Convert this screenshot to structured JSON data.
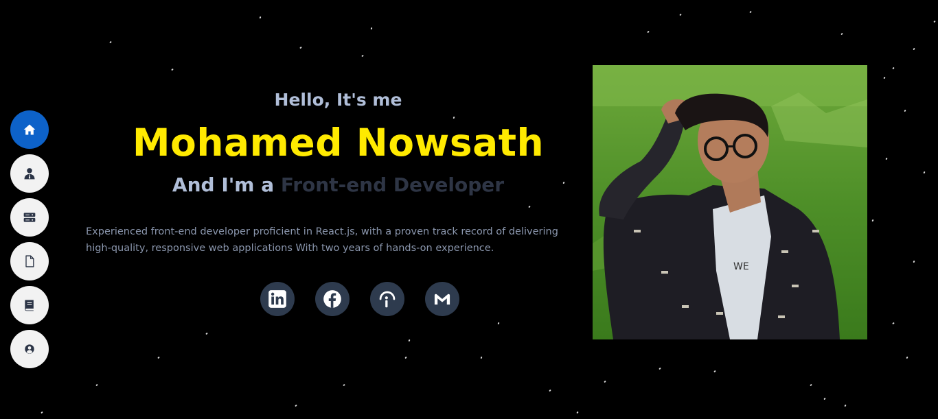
{
  "nav": {
    "items": [
      {
        "name": "home",
        "icon": "home-icon",
        "active": true
      },
      {
        "name": "about",
        "icon": "user-tie-icon",
        "active": false
      },
      {
        "name": "services",
        "icon": "server-icon",
        "active": false
      },
      {
        "name": "resume",
        "icon": "file-icon",
        "active": false
      },
      {
        "name": "portfolio",
        "icon": "book-icon",
        "active": false
      },
      {
        "name": "contact",
        "icon": "user-circle-icon",
        "active": false
      }
    ],
    "active_color": "#0d62c9"
  },
  "hero": {
    "greeting": "Hello, It's me",
    "name": "Mohamed Nowsath",
    "role_prefix": "And I'm a ",
    "role_typed": "Front-end Developer",
    "bio": "Experienced front-end developer proficient in React.js, with a proven track record of delivering high-quality, responsive web applications With two years of hands-on experience."
  },
  "socials": [
    {
      "name": "linkedin",
      "icon": "linkedin-icon"
    },
    {
      "name": "facebook",
      "icon": "facebook-icon"
    },
    {
      "name": "instapaper",
      "icon": "instapaper-icon"
    },
    {
      "name": "gmail",
      "icon": "gmail-icon"
    }
  ],
  "colors": {
    "background": "#000000",
    "name": "#ffea00",
    "greeting": "#b0bed8",
    "social_bg": "#2e3b4e"
  },
  "profile_photo": {
    "shirt_text": "WE"
  }
}
